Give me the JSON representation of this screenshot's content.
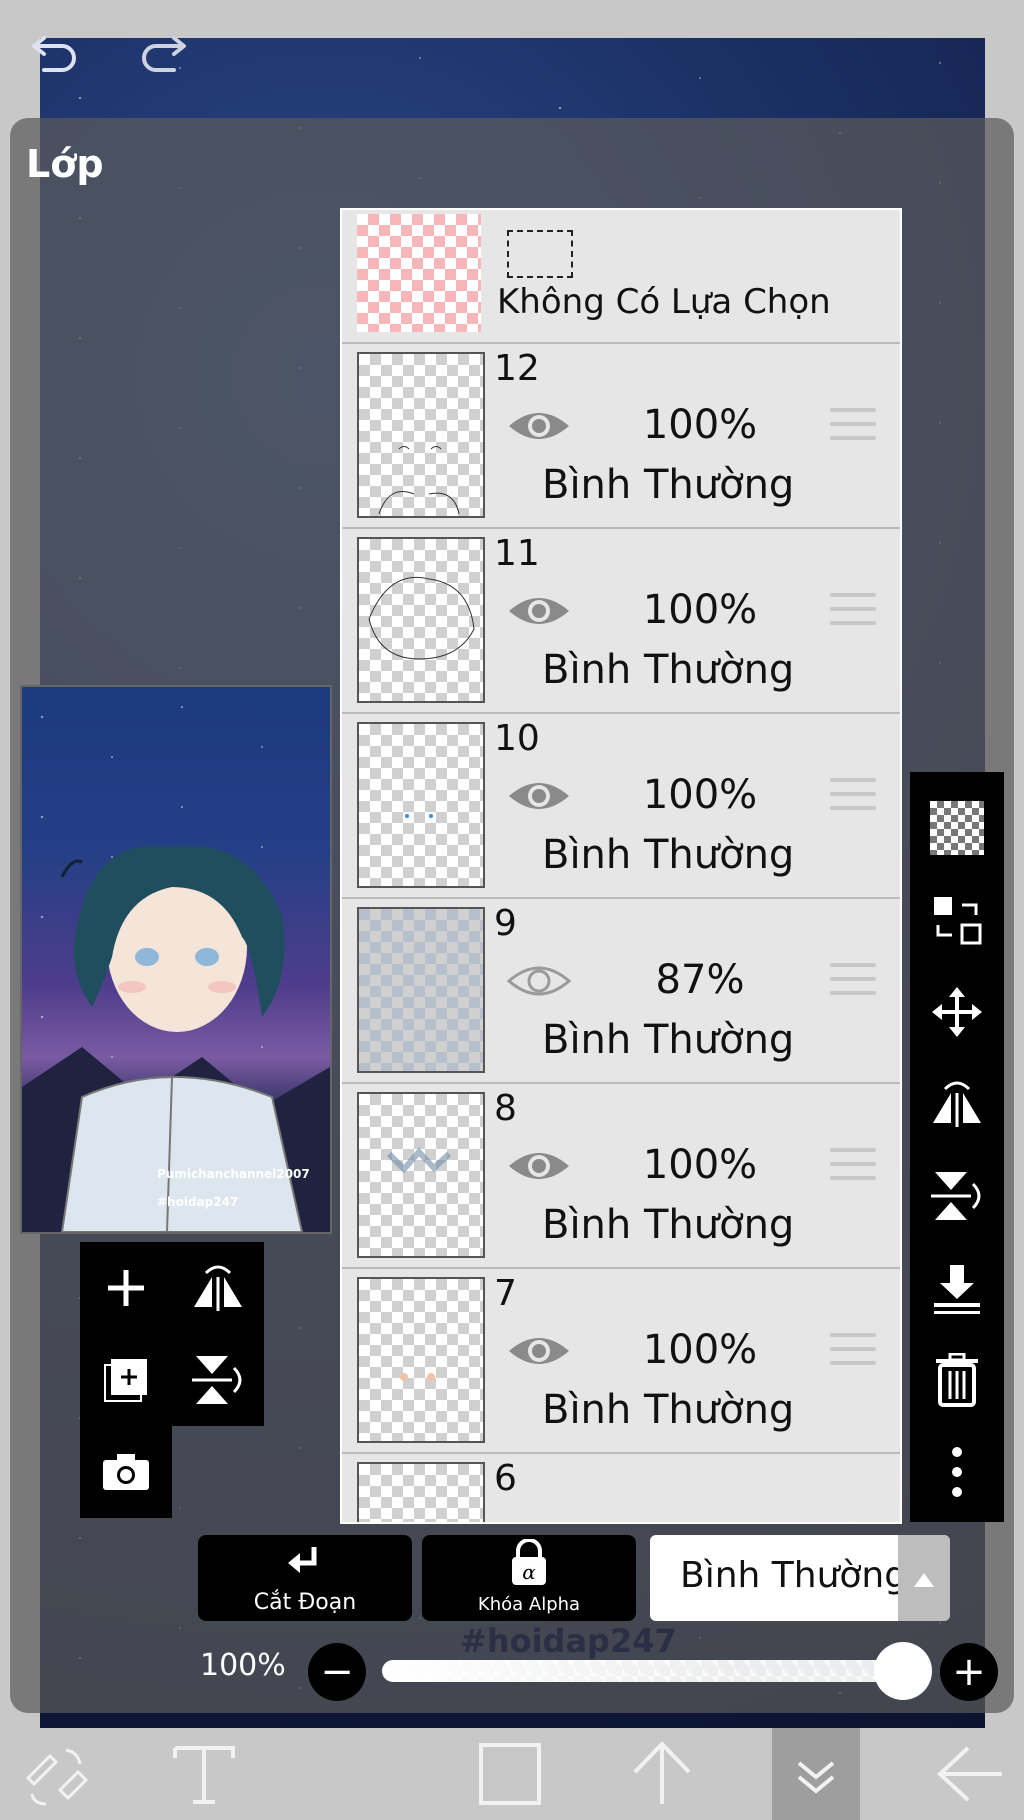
{
  "panel": {
    "title": "Lớp"
  },
  "selection_row": {
    "label": "Không Có Lựa Chọn"
  },
  "layers": [
    {
      "number": "12",
      "opacity": "100%",
      "blend": "Bình Thường",
      "visible": true
    },
    {
      "number": "11",
      "opacity": "100%",
      "blend": "Bình Thường",
      "visible": true
    },
    {
      "number": "10",
      "opacity": "100%",
      "blend": "Bình Thường",
      "visible": true
    },
    {
      "number": "9",
      "opacity": "87%",
      "blend": "Bình Thường",
      "visible": false
    },
    {
      "number": "8",
      "opacity": "100%",
      "blend": "Bình Thường",
      "visible": true
    },
    {
      "number": "7",
      "opacity": "100%",
      "blend": "Bình Thường",
      "visible": true
    },
    {
      "number": "6"
    }
  ],
  "preview": {
    "caption_line1": "Pumichanchannel2007",
    "caption_line2": "#hoidap247"
  },
  "controls": {
    "clip_label": "Cắt Đoạn",
    "alpha_lock_label": "Khóa Alpha",
    "blend_mode_value": "Bình Thường",
    "opacity_value": "100%",
    "opacity_fraction": 1.0,
    "canvas_hashtag": "#hoidap247"
  },
  "left_tools": [
    "add-layer-icon",
    "flip-horizontal-icon",
    "add-layer-copy-icon",
    "flip-vertical-icon",
    "camera-icon"
  ],
  "right_tools": [
    "transparency-icon",
    "swap-layers-icon",
    "move-icon",
    "flip-horizontal-icon",
    "flip-vertical-icon",
    "merge-down-icon",
    "trash-icon",
    "more-icon"
  ],
  "bottom_tools": [
    "brush-eraser-swap-icon",
    "text-tool-icon",
    "color-square-icon",
    "arrow-up-icon",
    "layers-collapse-icon",
    "back-arrow-icon"
  ],
  "colors": {
    "accent_dark": "#000000",
    "panel_bg": "#e6e6e6",
    "selection_checker": "#f7b6ba"
  }
}
